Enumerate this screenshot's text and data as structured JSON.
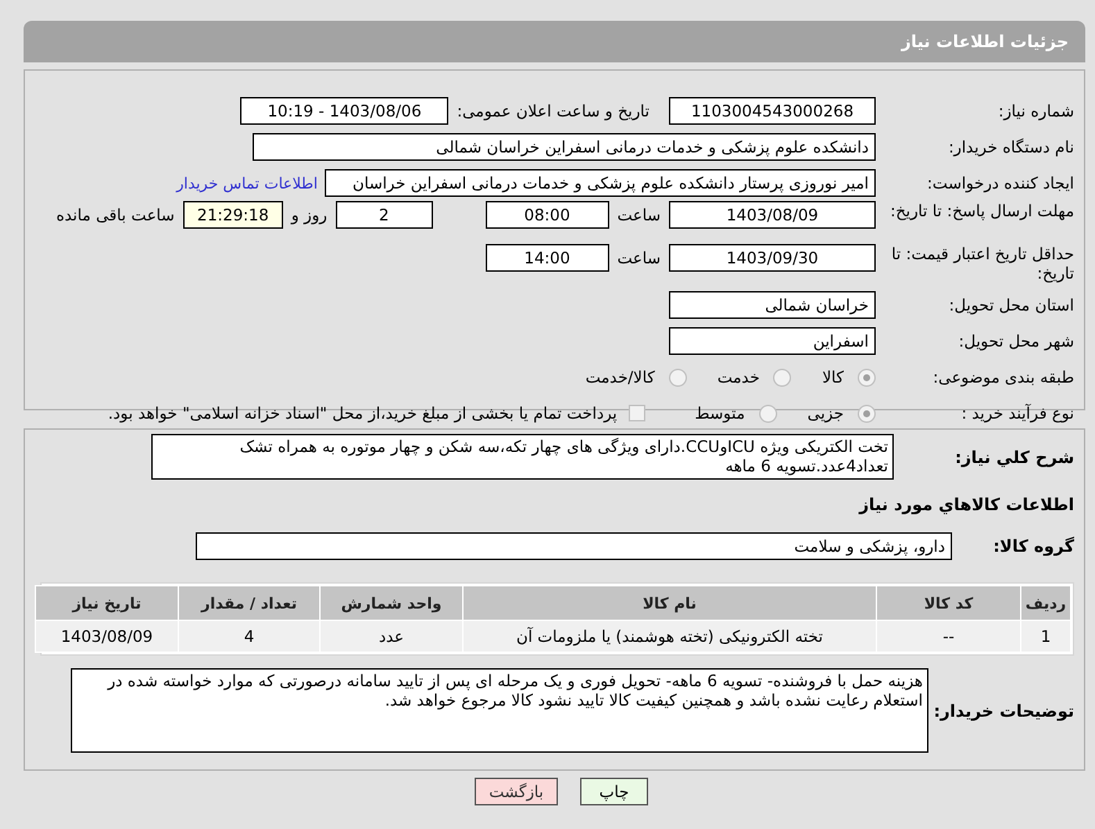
{
  "page_title": "جزئیات اطلاعات نیاز",
  "need_number": {
    "label": "شماره نیاز:",
    "value": "1103004543000268"
  },
  "announce": {
    "label": "تاریخ و ساعت اعلان عمومی:",
    "value": "1403/08/06 - 10:19"
  },
  "buyer_org": {
    "label": "نام دستگاه خریدار:",
    "value": "دانشکده علوم پزشکی و خدمات درمانی اسفراین خراسان شمالی"
  },
  "requester": {
    "label": "ایجاد کننده درخواست:",
    "value": "امیر  نوروزی  پرستار  دانشکده علوم پزشکی و خدمات درمانی اسفراین خراسان",
    "link": "اطلاعات تماس خریدار"
  },
  "reply_deadline": {
    "label": "مهلت ارسال پاسخ: تا تاریخ:",
    "date": "1403/08/09",
    "time_label": "ساعت",
    "time": "08:00",
    "days": "2",
    "days_label": "روز و",
    "remaining": "21:29:18",
    "remaining_label": "ساعت باقی مانده"
  },
  "price_validity": {
    "label": "حداقل تاریخ اعتبار قیمت: تا تاریخ:",
    "date": "1403/09/30",
    "time_label": "ساعت",
    "time": "14:00"
  },
  "province": {
    "label": "استان محل تحویل:",
    "value": "خراسان شمالی"
  },
  "city": {
    "label": "شهر محل تحویل:",
    "value": "اسفراین"
  },
  "category": {
    "label": "طبقه بندی موضوعی:",
    "options": [
      {
        "label": "کالا",
        "selected": true
      },
      {
        "label": "خدمت",
        "selected": false
      },
      {
        "label": "کالا/خدمت",
        "selected": false
      }
    ]
  },
  "process": {
    "label": "نوع فرآیند خرید :",
    "options": [
      {
        "label": "جزیی",
        "selected": true
      },
      {
        "label": "متوسط",
        "selected": false
      }
    ],
    "payment": {
      "label": "پرداخت تمام یا بخشی از مبلغ خرید،از محل \"اسناد خزانه اسلامی\" خواهد بود.",
      "checked": false
    }
  },
  "description": {
    "label": "شرح کلي نياز:",
    "value": "تخت الکتریکی ویژه ICUوCCU.دارای ویژگی های چهار تکه،سه شکن و چهار موتوره به همراه تشک\nتعداد4عدد.تسویه 6 ماهه"
  },
  "goods_heading": "اطلاعات کالاهاي مورد نياز",
  "goods_group": {
    "label": "گروه کالا:",
    "value": "دارو، پزشکی و سلامت"
  },
  "table": {
    "columns": [
      "ردیف",
      "کد کالا",
      "نام کالا",
      "واحد شمارش",
      "تعداد / مقدار",
      "تاریخ نیاز"
    ],
    "rows": [
      [
        "1",
        "--",
        "تخته الکترونیکی (تخته هوشمند) یا ملزومات آن",
        "عدد",
        "4",
        "1403/08/09"
      ]
    ]
  },
  "buyer_notes": {
    "label": "توضیحات خریدار:",
    "value": "هزینه حمل با فروشنده- تسویه 6 ماهه- تحویل فوری و یک مرحله ای پس از تایید سامانه درصورتی که موارد خواسته شده در استعلام رعایت نشده باشد و همچنین کیفیت کالا تایید نشود کالا مرجوع خواهد شد."
  },
  "buttons": [
    {
      "label": "چاپ",
      "kind": "print"
    },
    {
      "label": "بازگشت",
      "kind": "back"
    }
  ]
}
